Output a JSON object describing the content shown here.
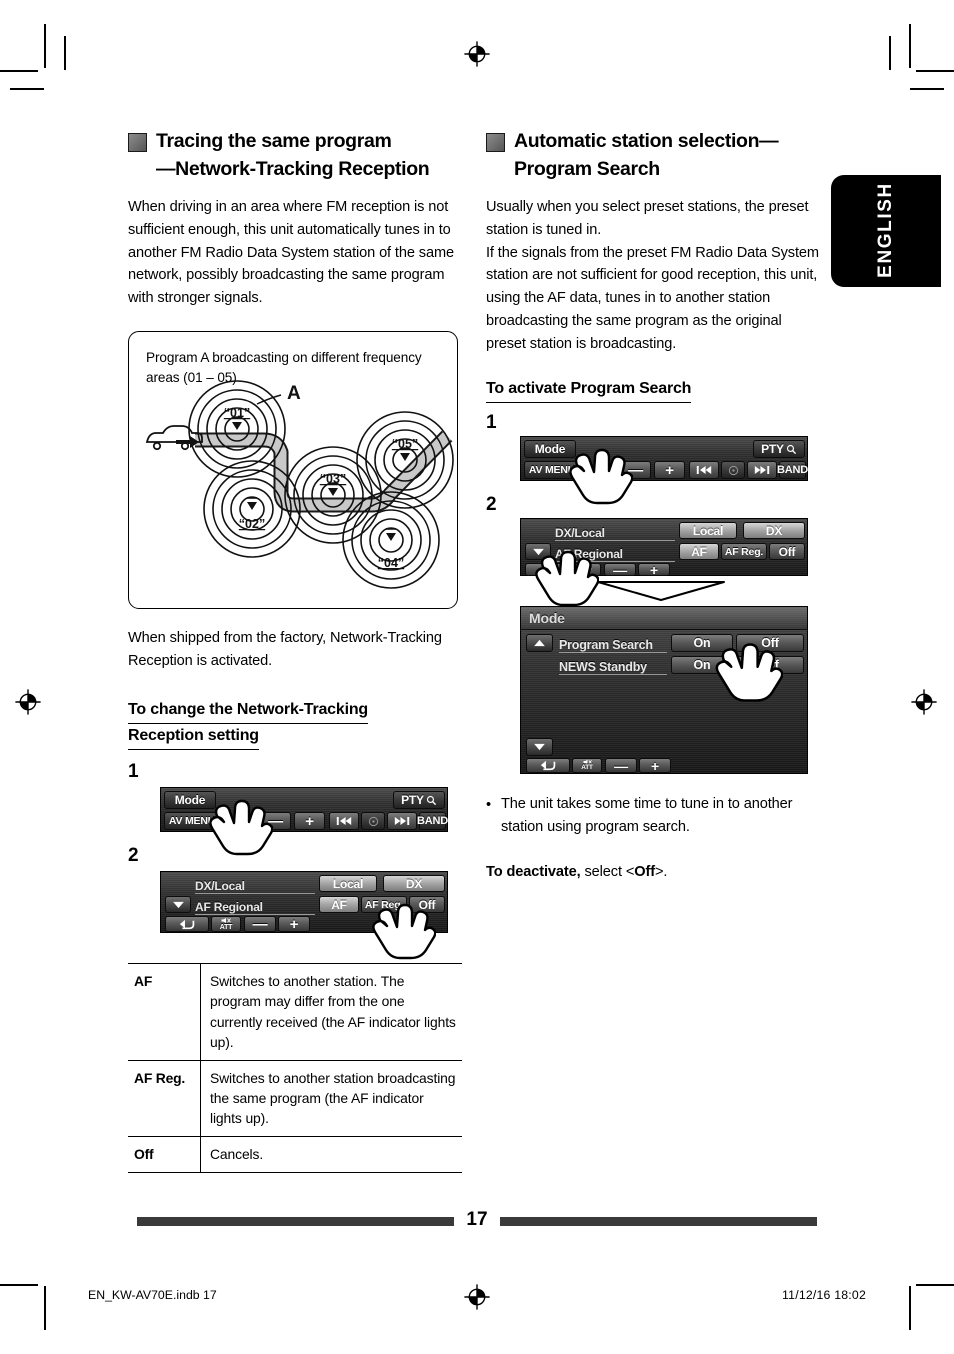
{
  "page": {
    "number": "17",
    "language_tab": "ENGLISH",
    "footer_file": "EN_KW-AV70E.indb   17",
    "footer_timestamp": "11/12/16   18:02"
  },
  "left_column": {
    "heading_line1": "Tracing the same program",
    "heading_line2": "—Network-Tracking Reception",
    "intro": "When driving in an area where FM reception is not sufficient enough, this unit automatically tunes in to another FM Radio Data System station of the same network, possibly broadcasting the same program with stronger signals.",
    "diagram": {
      "caption": "Program A broadcasting on different frequency areas (01 – 05)",
      "pointer_label": "A",
      "areas": [
        "“01”",
        "“02”",
        "“03”",
        "“04”",
        "“05”"
      ]
    },
    "note": "When shipped from the factory, Network-Tracking Reception is activated.",
    "subheading_line1": "To change the Network-Tracking",
    "subheading_line2": "Reception setting",
    "step1_number": "1",
    "step2_number": "2",
    "panel1": {
      "mode": "Mode",
      "pty": "PTY",
      "pty_icon": "magnifier-icon",
      "av_menu": "AV MENU",
      "minus": "—",
      "plus": "+",
      "prev": "prev-track-icon",
      "disc": "disc-icon",
      "next": "next-track-icon",
      "band": "BAND"
    },
    "panel2": {
      "row1_label": "DX/Local",
      "row1_opt1": "Local",
      "row1_opt2": "DX",
      "row2_label": "AF Regional",
      "row2_opt1": "AF",
      "row2_opt2": "AF Reg.",
      "row2_opt3": "Off",
      "back": "back-arrow-icon",
      "att": "ATT",
      "minus": "—",
      "plus": "+"
    },
    "table": {
      "rows": [
        {
          "key": "AF",
          "value": "Switches to another station. The program may differ from the one currently received (the AF indicator lights up)."
        },
        {
          "key": "AF Reg.",
          "value": "Switches to another station broadcasting the same program (the AF indicator lights up)."
        },
        {
          "key": "Off",
          "value": "Cancels."
        }
      ]
    }
  },
  "right_column": {
    "heading_line1": "Automatic station selection—",
    "heading_line2": "Program Search",
    "intro_p1": "Usually when you select preset stations, the preset station is tuned in.",
    "intro_p2": "If the signals from the preset FM Radio Data System station are not sufficient for good reception, this unit, using the AF data, tunes in to another station broadcasting the same program as the original preset station is broadcasting.",
    "subheading": "To activate Program Search",
    "step1_number": "1",
    "step2_number": "2",
    "panel1": {
      "mode": "Mode",
      "pty": "PTY",
      "pty_icon": "magnifier-icon",
      "av_menu": "AV MENU",
      "minus": "—",
      "plus": "+",
      "prev": "prev-track-icon",
      "disc": "disc-icon",
      "next": "next-track-icon",
      "band": "BAND"
    },
    "panel2a": {
      "row1_label": "DX/Local",
      "row1_opt1": "Local",
      "row1_opt2": "DX",
      "row2_label": "AF Regional",
      "row2_opt1": "AF",
      "row2_opt2": "AF Reg.",
      "row2_opt3": "Off",
      "scroll_down": "chevron-down-icon",
      "back": "back-arrow-icon",
      "att": "ATT",
      "minus": "—",
      "plus": "+"
    },
    "panel2b": {
      "title": "Mode",
      "scroll_up": "chevron-up-icon",
      "scroll_down": "chevron-down-icon",
      "row1_label": "Program Search",
      "row1_opt1": "On",
      "row1_opt2": "Off",
      "row2_label": "NEWS Standby",
      "row2_opt1": "On",
      "row2_opt2": "Off",
      "back": "back-arrow-icon",
      "att": "ATT",
      "minus": "—",
      "plus": "+"
    },
    "bullet": "The unit takes some time to tune in to another station using program search.",
    "deactivate_bold": "To deactivate,",
    "deactivate_rest": " select <",
    "deactivate_off": "Off",
    "deactivate_end": ">."
  }
}
